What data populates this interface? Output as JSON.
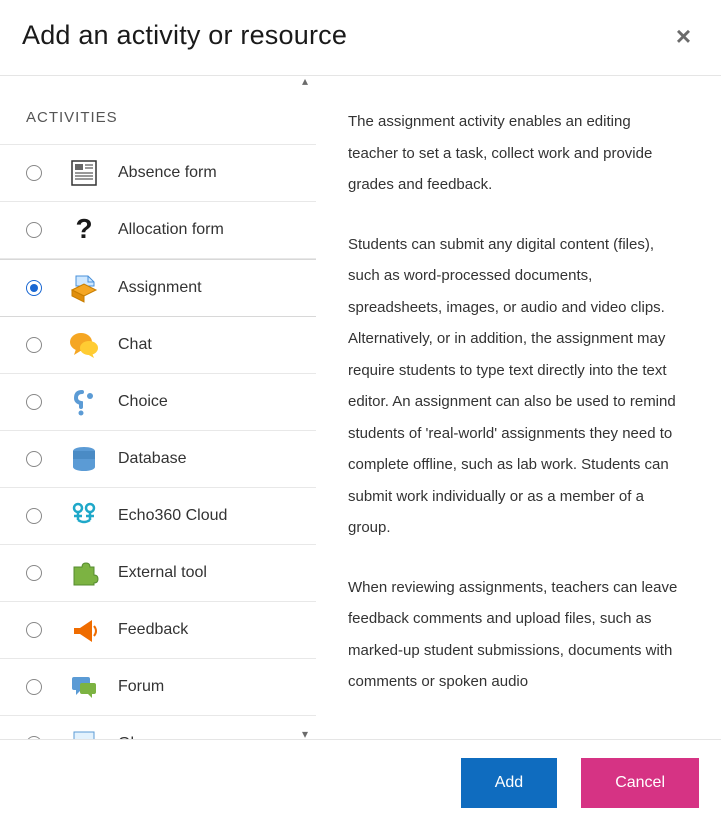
{
  "header": {
    "title": "Add an activity or resource",
    "close": "×"
  },
  "section_label": "ACTIVITIES",
  "activities": [
    {
      "label": "Absence form",
      "icon": "absence",
      "selected": false
    },
    {
      "label": "Allocation form",
      "icon": "question",
      "selected": false
    },
    {
      "label": "Assignment",
      "icon": "assignment",
      "selected": true
    },
    {
      "label": "Chat",
      "icon": "chat",
      "selected": false
    },
    {
      "label": "Choice",
      "icon": "choice",
      "selected": false
    },
    {
      "label": "Database",
      "icon": "database",
      "selected": false
    },
    {
      "label": "Echo360 Cloud",
      "icon": "echo360",
      "selected": false
    },
    {
      "label": "External tool",
      "icon": "puzzle",
      "selected": false
    },
    {
      "label": "Feedback",
      "icon": "megaphone",
      "selected": false
    },
    {
      "label": "Forum",
      "icon": "forum",
      "selected": false
    },
    {
      "label": "Glossary",
      "icon": "glossary",
      "selected": false
    }
  ],
  "description": {
    "p1": "The assignment activity enables an editing teacher to set a task, collect work and provide grades and feedback.",
    "p2": "Students can submit any digital content (files), such as word-processed documents, spreadsheets, images, or audio and video clips. Alternatively, or in addition, the assignment may require students to type text directly into the text editor. An assignment can also be used to remind students of 'real-world' assignments they need to complete offline, such as lab work. Students can submit work individually or as a member of a group.",
    "p3": "When reviewing assignments, teachers can leave feedback comments and upload files, such as marked-up student submissions, documents with comments or spoken audio"
  },
  "buttons": {
    "add": "Add",
    "cancel": "Cancel"
  }
}
